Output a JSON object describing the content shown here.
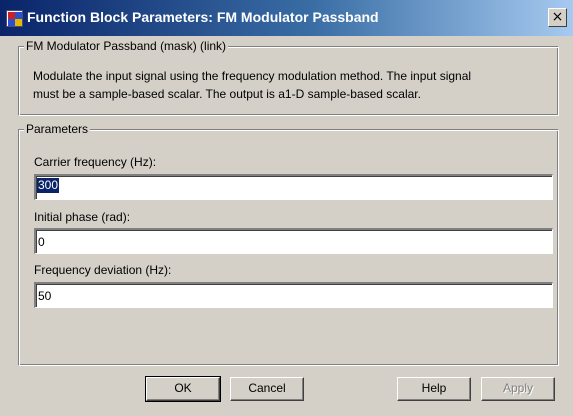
{
  "window": {
    "title": "Function Block Parameters: FM Modulator Passband",
    "close_glyph": "×"
  },
  "mask_group": {
    "legend": "FM Modulator Passband (mask) (link)",
    "description_line1": "Modulate the input signal using the frequency modulation method. The input signal",
    "description_line2": "must be a sample-based scalar. The output is a1-D sample-based scalar."
  },
  "parameters_group": {
    "legend": "Parameters",
    "fields": [
      {
        "label": "Carrier frequency (Hz):",
        "value": "300"
      },
      {
        "label": "Initial phase (rad):",
        "value": "0"
      },
      {
        "label": "Frequency deviation (Hz):",
        "value": "50"
      }
    ]
  },
  "buttons": {
    "ok": "OK",
    "cancel": "Cancel",
    "help": "Help",
    "apply": "Apply"
  },
  "icons": {
    "window_icon": "simulink-block-icon",
    "close": "close-icon"
  }
}
